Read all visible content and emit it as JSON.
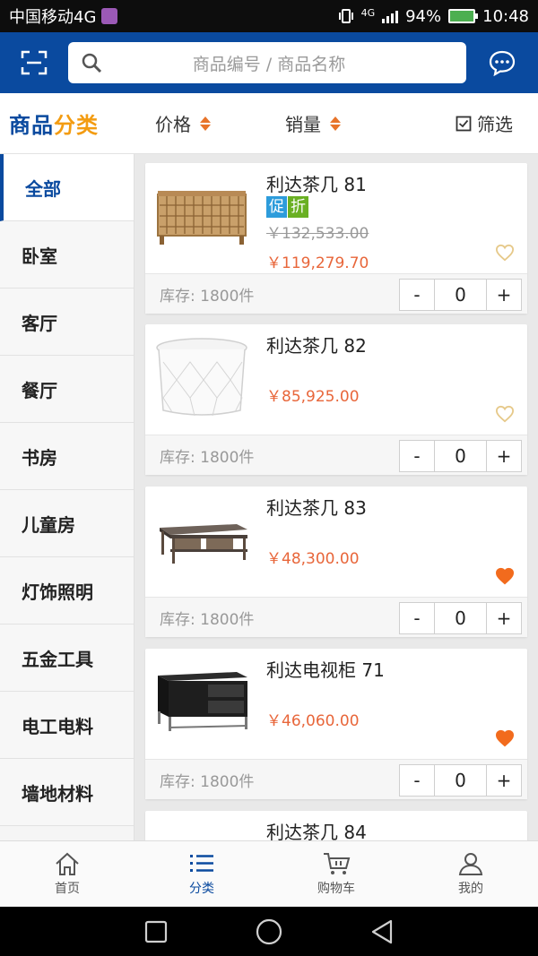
{
  "status_bar": {
    "carrier": "中国移动4G",
    "network_small": "4G",
    "battery": "94%",
    "time": "10:48"
  },
  "header": {
    "search_placeholder": "商品编号 / 商品名称"
  },
  "filter_bar": {
    "brand_part1": "商品",
    "brand_part2": "分类",
    "sort_price": "价格",
    "sort_sales": "销量",
    "filter": "筛选"
  },
  "sidebar": {
    "items": [
      {
        "label": "全部"
      },
      {
        "label": "卧室"
      },
      {
        "label": "客厅"
      },
      {
        "label": "餐厅"
      },
      {
        "label": "书房"
      },
      {
        "label": "儿童房"
      },
      {
        "label": "灯饰照明"
      },
      {
        "label": "五金工具"
      },
      {
        "label": "电工电料"
      },
      {
        "label": "墙地材料"
      }
    ]
  },
  "products": [
    {
      "name": "利达茶几 81",
      "tag_promo": "促",
      "tag_discount": "折",
      "old_price": "￥132,533.00",
      "price": "￥119,279.70",
      "stock": "库存:  1800件",
      "qty": "0",
      "minus": "-",
      "plus": "+",
      "favorited": false
    },
    {
      "name": "利达茶几 82",
      "price": "￥85,925.00",
      "stock": "库存:  1800件",
      "qty": "0",
      "minus": "-",
      "plus": "+",
      "favorited": false
    },
    {
      "name": "利达茶几 83",
      "price": "￥48,300.00",
      "stock": "库存:  1800件",
      "qty": "0",
      "minus": "-",
      "plus": "+",
      "favorited": true
    },
    {
      "name": "利达电视柜 71",
      "price": "￥46,060.00",
      "stock": "库存:  1800件",
      "qty": "0",
      "minus": "-",
      "plus": "+",
      "favorited": true
    },
    {
      "name": "利达茶几 84"
    }
  ],
  "bottom_nav": {
    "items": [
      {
        "label": "首页"
      },
      {
        "label": "分类"
      },
      {
        "label": "购物车"
      },
      {
        "label": "我的"
      }
    ]
  },
  "colors": {
    "primary": "#0a4a9f",
    "accent": "#f39c12",
    "price": "#e8663a",
    "heart_on": "#f26b1d",
    "heart_off": "#e6c98a"
  }
}
